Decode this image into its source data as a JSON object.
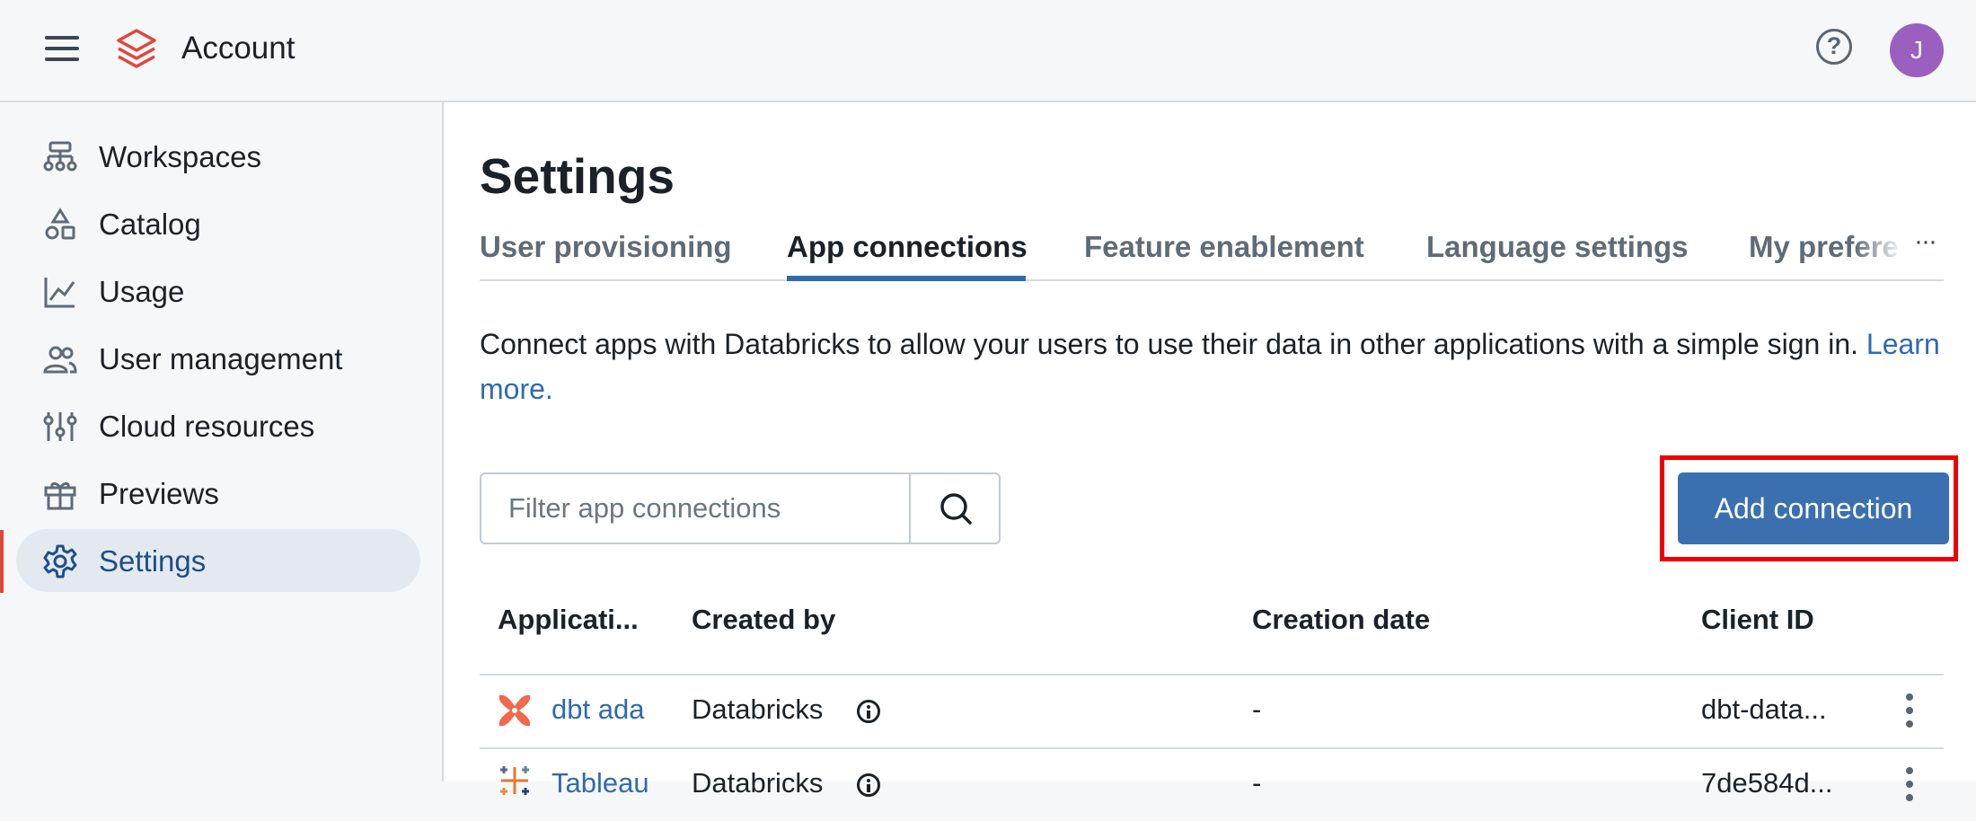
{
  "header": {
    "app_title": "Account",
    "avatar_initial": "J",
    "help_glyph": "?"
  },
  "sidebar": {
    "items": [
      {
        "label": "Workspaces",
        "icon": "workspaces-icon"
      },
      {
        "label": "Catalog",
        "icon": "catalog-icon"
      },
      {
        "label": "Usage",
        "icon": "usage-chart-icon"
      },
      {
        "label": "User management",
        "icon": "users-icon"
      },
      {
        "label": "Cloud resources",
        "icon": "sliders-icon"
      },
      {
        "label": "Previews",
        "icon": "gift-icon"
      },
      {
        "label": "Settings",
        "icon": "gear-icon",
        "active": true
      }
    ]
  },
  "main": {
    "title": "Settings",
    "tabs": [
      {
        "label": "User provisioning"
      },
      {
        "label": "App connections",
        "active": true
      },
      {
        "label": "Feature enablement"
      },
      {
        "label": "Language settings"
      },
      {
        "label": "My prefere"
      }
    ],
    "tabs_more": "···",
    "description": "Connect apps with Databricks to allow your users to use their data in other applications with a simple sign in.",
    "learn_more": "Learn more.",
    "filter_placeholder": "Filter app connections",
    "add_button": "Add connection",
    "table": {
      "columns": [
        "Applicati...",
        "Created by",
        "Creation date",
        "Client ID"
      ],
      "rows": [
        {
          "app": "dbt ada",
          "created_by": "Databricks",
          "creation_date": "-",
          "client_id": "dbt-data...",
          "icon": "dbt-logo-icon"
        },
        {
          "app": "Tableau",
          "created_by": "Databricks",
          "creation_date": "-",
          "client_id": "7de584d...",
          "icon": "tableau-logo-icon"
        }
      ]
    }
  },
  "colors": {
    "accent": "#2f6ab0",
    "primary_button": "#3a6fb0",
    "highlight": "#ee0000",
    "brand": "#e0463a",
    "avatar": "#9b5fc0"
  }
}
